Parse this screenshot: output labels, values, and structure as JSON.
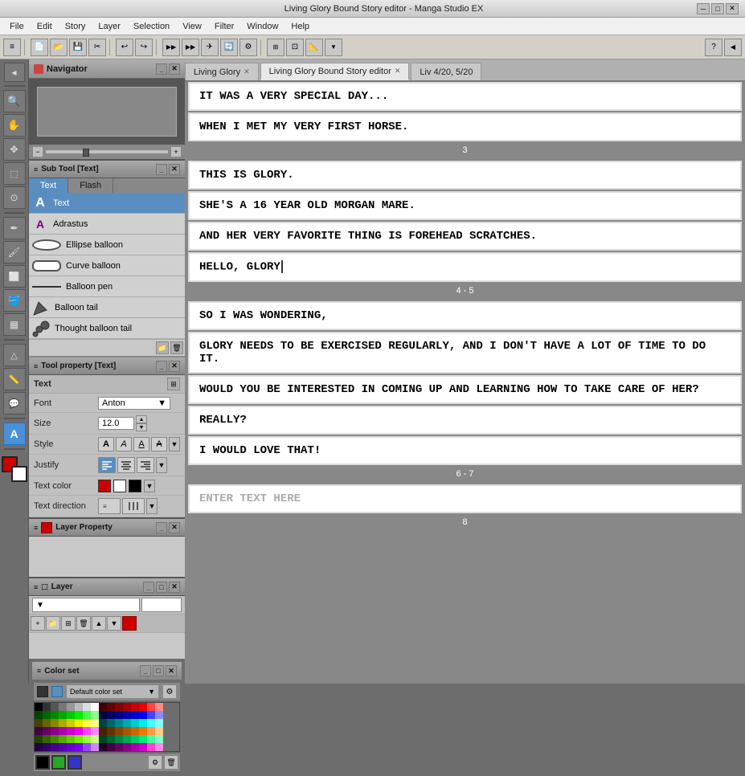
{
  "titleBar": {
    "title": "Living Glory Bound Story editor - Manga Studio EX",
    "minBtn": "─",
    "maxBtn": "□",
    "closeBtn": "✕"
  },
  "menuBar": {
    "items": [
      "File",
      "Edit",
      "Story",
      "Layer",
      "Selection",
      "View",
      "Filter",
      "Window",
      "Help"
    ]
  },
  "tabs": [
    {
      "label": "Living Glory",
      "active": false,
      "closable": true
    },
    {
      "label": "Living Glory Bound Story editor",
      "active": true,
      "closable": true
    },
    {
      "label": "Liv 4/20, 5/20",
      "active": false,
      "closable": false
    }
  ],
  "subToolPanel": {
    "header": "Sub Tool [Text]",
    "tabs": [
      {
        "label": "Text",
        "active": true
      },
      {
        "label": "Flash",
        "active": false
      }
    ],
    "items": [
      {
        "name": "Text",
        "icon": "A",
        "iconStyle": "normal"
      },
      {
        "name": "Adrastus",
        "icon": "A",
        "iconStyle": "purple"
      },
      {
        "name": "Ellipse balloon",
        "icon": "ellipse",
        "iconStyle": "balloon"
      },
      {
        "name": "Curve balloon",
        "icon": "curve",
        "iconStyle": "balloon-curve"
      },
      {
        "name": "Balloon pen",
        "icon": "pen",
        "iconStyle": "pen"
      },
      {
        "name": "Balloon tail",
        "icon": "tail",
        "iconStyle": "tail"
      },
      {
        "name": "Thought balloon tail",
        "icon": "tail2",
        "iconStyle": "tail2"
      }
    ]
  },
  "toolProperty": {
    "header": "Tool property [Text]",
    "sectionLabel": "Text",
    "font": {
      "label": "Font",
      "value": "Anton"
    },
    "size": {
      "label": "Size",
      "value": "12.0"
    },
    "style": {
      "label": "Style"
    },
    "justify": {
      "label": "Justify",
      "options": [
        "left",
        "center",
        "right"
      ]
    },
    "textColor": {
      "label": "Text color"
    },
    "textDirection": {
      "label": "Text direction"
    }
  },
  "layerProperty": {
    "header": "Layer Property"
  },
  "layerPanel": {
    "header": "Layer"
  },
  "colorPanel": {
    "header": "Default color set"
  },
  "navigator": {
    "header": "Navigator"
  },
  "storyPanels": [
    {
      "id": "panel-1",
      "texts": [
        "IT WAS A VERY SPECIAL DAY...",
        "WHEN I MET MY VERY FIRST HORSE."
      ],
      "pageNum": "3"
    },
    {
      "id": "panel-2",
      "texts": [
        "THIS IS GLORY.",
        "SHE'S A 16 YEAR OLD MORGAN MARE.",
        "AND HER VERY FAVORITE THING IS FOREHEAD SCRATCHES.",
        "HELLO, GLORY|"
      ],
      "pageNum": "4 - 5"
    },
    {
      "id": "panel-3",
      "texts": [
        "SO I WAS WONDERING,",
        "GLORY NEEDS TO BE EXERCISED REGULARLY, AND I DON'T HAVE A LOT OF TIME TO DO IT.",
        "WOULD YOU BE INTERESTED IN COMING UP AND LEARNING HOW TO TAKE CARE OF HER?",
        "REALLY?",
        "I WOULD LOVE THAT!"
      ],
      "pageNum": "6 - 7"
    },
    {
      "id": "panel-4",
      "texts": [
        "ENTER TEXT HERE"
      ],
      "pageNum": "8",
      "placeholder": true
    }
  ],
  "colors": {
    "foreground": "#cc0000",
    "background": "#ffffff",
    "text1": "#cc0000",
    "text2": "#ffffff",
    "text3": "#000000"
  },
  "colorGrid": [
    "#000000",
    "#333333",
    "#555555",
    "#777777",
    "#999999",
    "#bbbbbb",
    "#dddddd",
    "#ffffff",
    "#440000",
    "#660000",
    "#880000",
    "#aa0000",
    "#cc0000",
    "#ee0000",
    "#ff4444",
    "#ff8888",
    "#004400",
    "#006600",
    "#008800",
    "#00aa00",
    "#00cc00",
    "#00ee00",
    "#44ff44",
    "#88ff88",
    "#000044",
    "#000066",
    "#000088",
    "#0000aa",
    "#0000cc",
    "#0000ee",
    "#4444ff",
    "#8888ff",
    "#444400",
    "#666600",
    "#888800",
    "#aaaa00",
    "#cccc00",
    "#eeee00",
    "#ffff44",
    "#ffff88",
    "#004444",
    "#006666",
    "#008888",
    "#00aaaa",
    "#00cccc",
    "#00eeee",
    "#44ffff",
    "#88ffff",
    "#440044",
    "#660066",
    "#880088",
    "#aa00aa",
    "#cc00cc",
    "#ee00ee",
    "#ff44ff",
    "#ff88ff",
    "#442200",
    "#663300",
    "#884400",
    "#aa5500",
    "#cc6600",
    "#ee7700",
    "#ff9944",
    "#ffcc88",
    "#224400",
    "#336600",
    "#448800",
    "#55aa00",
    "#66cc00",
    "#77ee00",
    "#99ff44",
    "#ccff88",
    "#004422",
    "#006633",
    "#008844",
    "#00aa55",
    "#00cc66",
    "#00ee77",
    "#44ff99",
    "#88ffcc",
    "#220044",
    "#330066",
    "#440088",
    "#5500aa",
    "#6600cc",
    "#7700ee",
    "#9944ff",
    "#cc88ff",
    "#220022",
    "#440044",
    "#660066",
    "#880088",
    "#aa00aa",
    "#cc00cc",
    "#ff44cc",
    "#ff88ee"
  ]
}
